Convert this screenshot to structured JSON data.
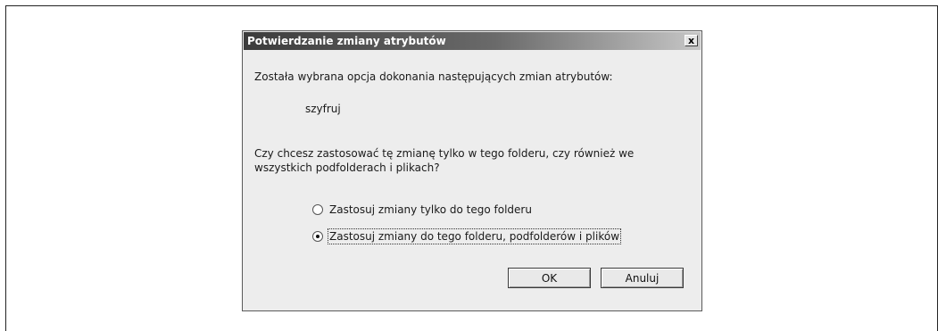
{
  "dialog": {
    "title": "Potwierdzanie zmiany atrybutów",
    "close_glyph": "x",
    "intro": "Została wybrana opcja dokonania następujących zmian atrybutów:",
    "attribute_change": "szyfruj",
    "question_line1": "Czy chcesz zastosować tę zmianę tylko w tego folderu, czy również we",
    "question_line2": "wszystkich podfolderach i plikach?",
    "options": [
      {
        "label": "Zastosuj zmiany tylko do tego folderu",
        "selected": false
      },
      {
        "label": "Zastosuj zmiany do tego folderu, podfolderów i plików",
        "selected": true
      }
    ],
    "ok_label": "OK",
    "cancel_label": "Anuluj"
  }
}
